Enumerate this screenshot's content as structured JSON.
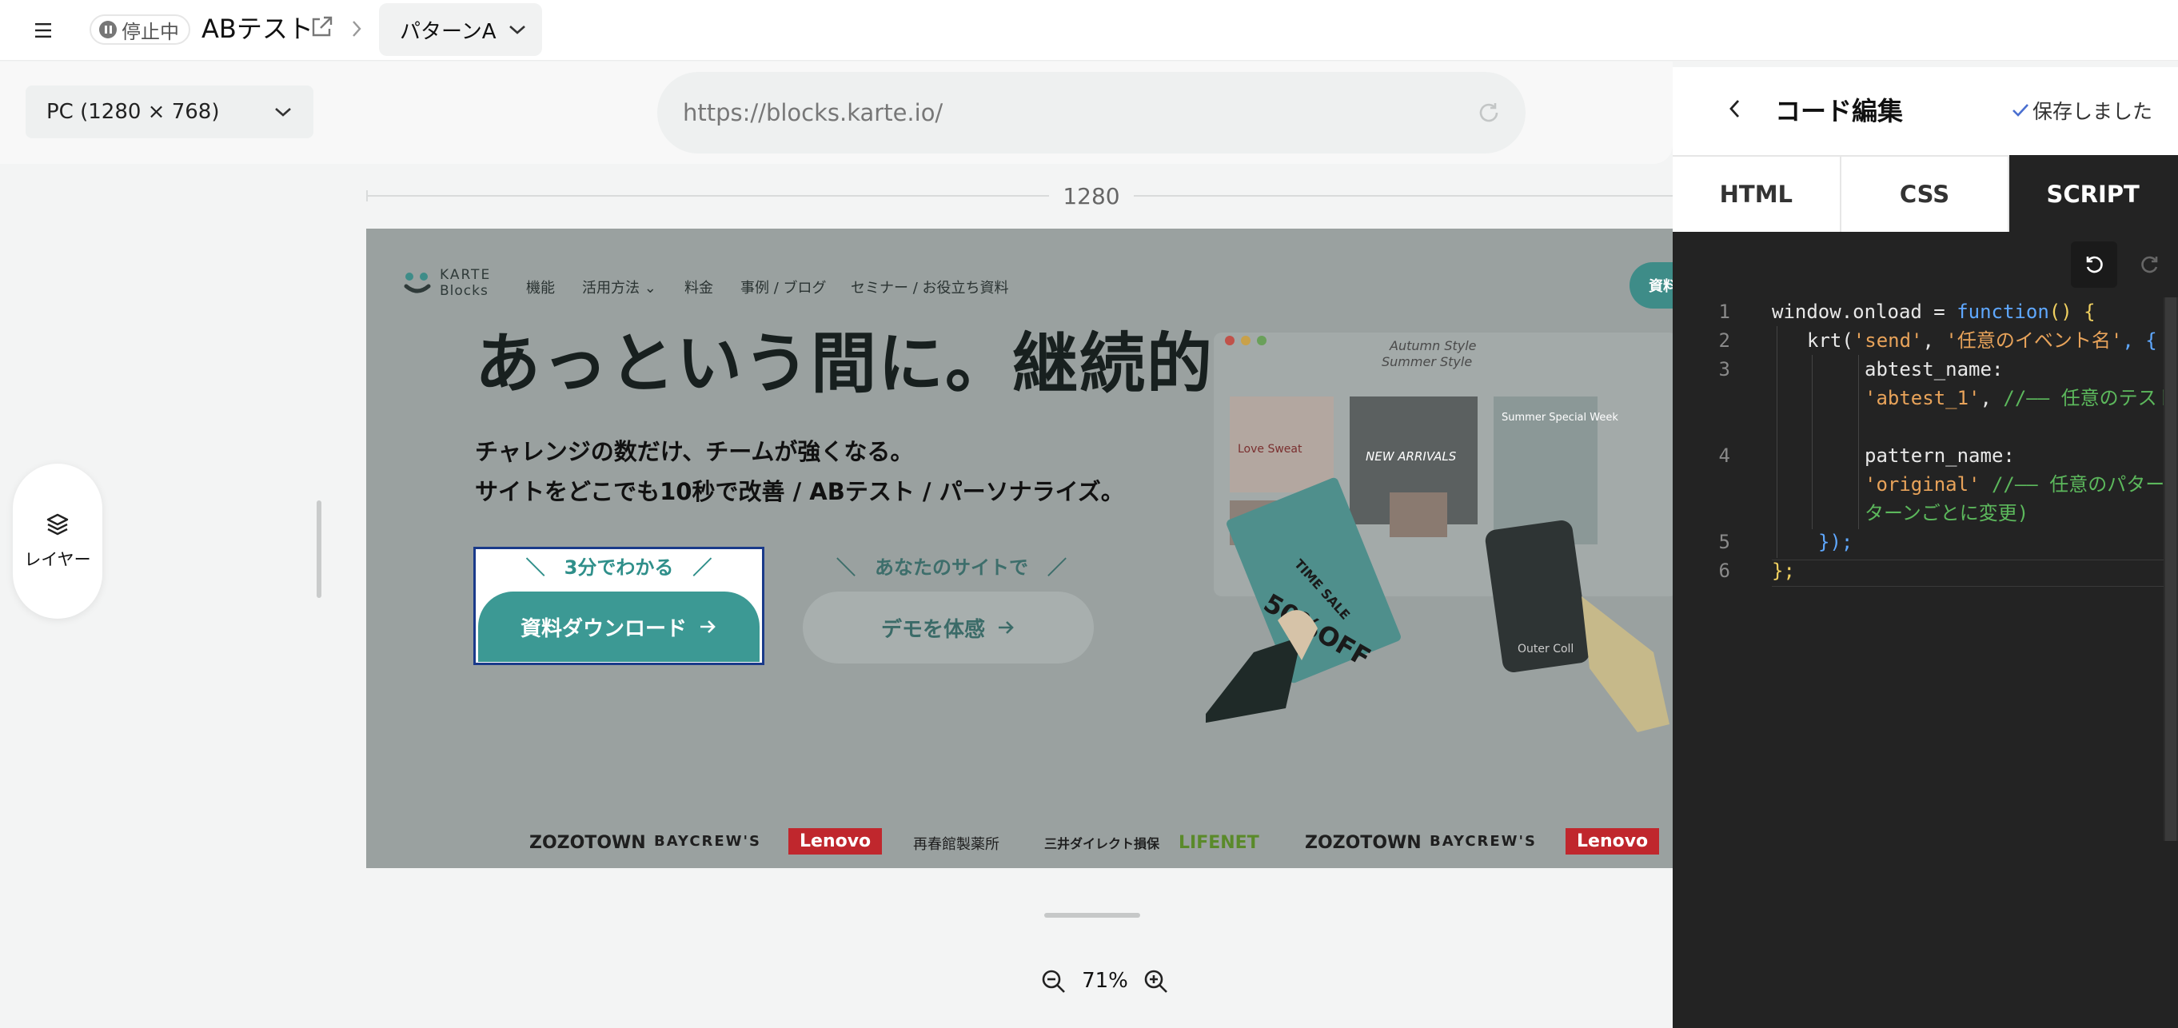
{
  "topbar": {
    "status_label": "停止中",
    "campaign_title": "ABテスト",
    "pattern_label": "パターンA"
  },
  "devicebar": {
    "device_label": "PC (1280 × 768)",
    "url": "https://blocks.karte.io/"
  },
  "ruler": {
    "width_label": "1280"
  },
  "layer_button": {
    "label": "レイヤー"
  },
  "preview": {
    "logo_line1": "KARTE",
    "logo_line2": "Blocks",
    "nav": [
      "機能",
      "活用方法",
      "料金",
      "事例 / ブログ",
      "セミナー / お役立ち資料"
    ],
    "cta_top": "資料",
    "headline": "あっという間に。継続的に。",
    "sub1": "チャレンジの数だけ、チームが強くなる。",
    "sub2": "サイトをどこでも10秒で改善 / ABテスト / パーソナライズ。",
    "cta_caption1": "＼　3分でわかる　／",
    "download_label": "資料ダウンロード",
    "cta_caption2": "＼　あなたのサイトで　／",
    "demo_label": "デモを体感",
    "logos": [
      "ZOZOTOWN",
      "BAYCREW'S",
      "Lenovo",
      "再春館製薬所",
      "三井ダイレクト損保",
      "LIFENET",
      "ZOZOTOWN",
      "BAYCREW'S",
      "Lenovo"
    ],
    "illus_text": [
      "Autumn Style",
      "Summer Style",
      "NEW ARRIVALS",
      "Summer Special Week",
      "TIME SALE",
      "50%OFF",
      "Love Sweat",
      "Outer Coll"
    ]
  },
  "zoom": {
    "level": "71%"
  },
  "panel": {
    "title": "コード編集",
    "save_status": "保存しました",
    "tabs": [
      "HTML",
      "CSS",
      "SCRIPT"
    ],
    "active_tab": "SCRIPT"
  },
  "code": {
    "line_numbers": [
      "1",
      "2",
      "3",
      "4",
      "5",
      "6"
    ],
    "l1_a": "window.onload = ",
    "l1_b": "function",
    "l1_c": "() {",
    "l2_a": "krt(",
    "l2_b": "'send'",
    "l2_c": ", ",
    "l2_d": "'任意のイベント名'",
    "l2_e": ", {",
    "l3_key": "abtest_name:",
    "l3_val": "'abtest_1'",
    "l3_comma": ", ",
    "l3_cmt": "//—— 任意のテスト名",
    "l4_key": "pattern_name:",
    "l4_val": "'original'",
    "l4_cmt": " //—— 任意のパターン名(パターンごとに変更)",
    "l5": "});",
    "l6": "};"
  },
  "colors": {
    "accent_teal": "#3c9994",
    "editor_bg": "#232323",
    "cta_border": "#1a3a8a"
  },
  "icons": [
    "hamburger-icon",
    "pause-icon",
    "external-link-icon",
    "chevron-right-icon",
    "chevron-down-icon",
    "reload-icon",
    "layers-icon",
    "zoom-out-icon",
    "zoom-in-icon",
    "chevron-left-icon",
    "check-icon",
    "undo-icon",
    "redo-icon"
  ]
}
